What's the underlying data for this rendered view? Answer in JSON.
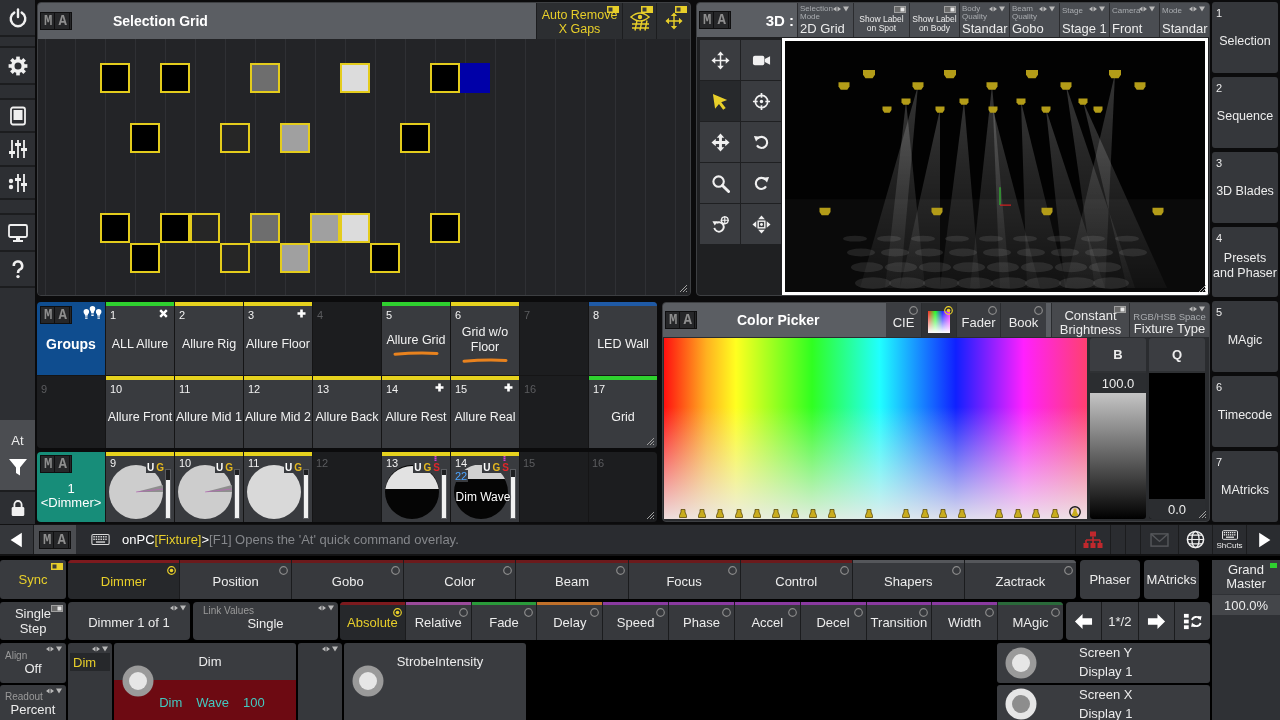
{
  "left_toolbar": {
    "filter_label": "At"
  },
  "selection_grid": {
    "logo": "MA",
    "title": "Selection Grid",
    "buttons": [
      {
        "kind": "text",
        "label": "Auto Remove X Gaps",
        "on": true
      },
      {
        "kind": "eye-grid",
        "on": true
      },
      {
        "kind": "move",
        "on": true
      }
    ],
    "rows": [
      {
        "cells": [
          {
            "color": "#000000",
            "selected": true
          },
          null,
          {
            "color": "#000000",
            "selected": true
          },
          null,
          null,
          {
            "color": "#6e6e6e",
            "selected": true
          },
          null,
          null,
          {
            "color": "#dcdcdc",
            "selected": true
          },
          null,
          null,
          {
            "color": "#000000",
            "selected": true
          },
          {
            "color": "#0000a8",
            "selected": false
          }
        ]
      },
      {
        "cells": [
          null,
          null,
          null,
          null,
          null,
          null,
          null,
          null,
          null,
          null,
          null,
          null,
          null
        ]
      },
      {
        "cells": [
          null,
          {
            "color": "#000000",
            "selected": true
          },
          null,
          null,
          {
            "color": "#262626",
            "selected": true
          },
          null,
          {
            "color": "#a0a0a0",
            "selected": true
          },
          null,
          null,
          null,
          {
            "color": "#000000",
            "selected": true
          },
          null,
          null
        ]
      },
      {
        "cells": [
          null,
          null,
          null,
          null,
          null,
          null,
          null,
          null,
          null,
          null,
          null,
          null,
          null
        ]
      },
      {
        "cells": [
          null,
          null,
          null,
          null,
          null,
          null,
          null,
          null,
          null,
          null,
          null,
          null,
          null
        ]
      },
      {
        "cells": [
          {
            "color": "#000000",
            "selected": true
          },
          null,
          {
            "color": "#000000",
            "selected": true
          },
          {
            "color": "#262626",
            "selected": true
          },
          null,
          {
            "color": "#6e6e6e",
            "selected": true
          },
          null,
          {
            "color": "#a0a0a0",
            "selected": true
          },
          {
            "color": "#dcdcdc",
            "selected": true
          },
          null,
          null,
          {
            "color": "#000000",
            "selected": true
          },
          null
        ]
      },
      {
        "cells": [
          null,
          {
            "color": "#000000",
            "selected": true
          },
          null,
          null,
          {
            "color": "#262626",
            "selected": true
          },
          null,
          {
            "color": "#a0a0a0",
            "selected": true
          },
          null,
          null,
          {
            "color": "#000000",
            "selected": true
          },
          null,
          null,
          null
        ]
      }
    ]
  },
  "viewer_3d": {
    "logo": "MA",
    "title": "3D :",
    "options": [
      {
        "kind": "select",
        "title": "Selection Mode",
        "value": "2D Grid"
      },
      {
        "kind": "toggle",
        "label": "Show Label on Spot",
        "on": false
      },
      {
        "kind": "toggle",
        "label": "Show Label on Body",
        "on": false
      },
      {
        "kind": "select",
        "title": "Body Quality",
        "value": "Standar"
      },
      {
        "kind": "select",
        "title": "Beam Quality",
        "value": "Gobo"
      },
      {
        "kind": "select",
        "title": "Stage",
        "value": "Stage 1"
      },
      {
        "kind": "select",
        "title": "Camera",
        "value": "Front"
      },
      {
        "kind": "select",
        "title": "Mode",
        "value": "Standar"
      }
    ],
    "tools": [
      {
        "selected": false
      },
      {
        "selected": false
      },
      {
        "selected": true
      },
      {
        "selected": false
      },
      {
        "selected": false
      },
      {
        "selected": false
      },
      {
        "selected": false
      },
      {
        "selected": false
      },
      {
        "selected": false
      },
      {
        "selected": false
      }
    ]
  },
  "view_buttons": [
    {
      "number": "1",
      "label": "Selection"
    },
    {
      "number": "2",
      "label": "Sequence"
    },
    {
      "number": "3",
      "label": "3D Blades"
    },
    {
      "number": "4",
      "label": "Presets and Phaser"
    },
    {
      "number": "5",
      "label": "MAgic"
    },
    {
      "number": "6",
      "label": "Timecode"
    },
    {
      "number": "7",
      "label": "MAtricks"
    }
  ],
  "groups_pool": {
    "logo": "MA",
    "title": "Groups",
    "items": [
      {
        "number": "1",
        "kind": "cross",
        "label": "ALL Allure",
        "color": "#2fd12f",
        "highlighted": false
      },
      {
        "number": "2",
        "kind": "plain",
        "label": "Allure Rig",
        "color": "#e6d21e",
        "highlighted": false
      },
      {
        "number": "3",
        "kind": "plus",
        "label": "Allure Floor",
        "color": "#e6d21e",
        "highlighted": false
      },
      {
        "number": "4",
        "kind": "empty"
      },
      {
        "number": "5",
        "kind": "plain",
        "label": "Allure Grid",
        "color": "#2fd12f",
        "highlighted": true
      },
      {
        "number": "6",
        "kind": "plain",
        "label": "Grid w/o Floor",
        "color": "#e6d21e",
        "highlighted": true
      },
      {
        "number": "7",
        "kind": "empty"
      },
      {
        "number": "8",
        "kind": "plain",
        "label": "LED Wall",
        "color": "#1f5aa6",
        "highlighted": false
      },
      {
        "number": "9",
        "kind": "empty"
      },
      {
        "number": "10",
        "kind": "plain",
        "label": "Allure Front",
        "color": "#e6d21e",
        "highlighted": false
      },
      {
        "number": "11",
        "kind": "plain",
        "label": "Allure Mid 1",
        "color": "#e6d21e",
        "highlighted": false
      },
      {
        "number": "12",
        "kind": "plain",
        "label": "Allure Mid 2",
        "color": "#e6d21e",
        "highlighted": false
      },
      {
        "number": "13",
        "kind": "plain",
        "label": "Allure Back",
        "color": "#e6d21e",
        "highlighted": false
      },
      {
        "number": "14",
        "kind": "plus",
        "label": "Allure Rest",
        "color": "#e6d21e",
        "highlighted": false
      },
      {
        "number": "15",
        "kind": "plus",
        "label": "Allure Real",
        "color": "#e6d21e",
        "highlighted": false
      },
      {
        "number": "16",
        "kind": "empty"
      },
      {
        "number": "17",
        "kind": "plain",
        "label": "Grid",
        "color": "#2fd12f",
        "highlighted": false
      }
    ]
  },
  "dimmer_pool": {
    "logo": "MA",
    "number": "1",
    "title": "<Dimmer>",
    "items": [
      {
        "number": "9",
        "kind": "pie",
        "color": "#e6d21e",
        "tags": [
          {
            "text": "U",
            "color": "#ffffff"
          },
          {
            "text": "G",
            "color": "#e6b91e"
          }
        ],
        "phaser": false,
        "level": 0.8
      },
      {
        "number": "10",
        "kind": "pie",
        "color": "#e6d21e",
        "tags": [
          {
            "text": "U",
            "color": "#ffffff"
          },
          {
            "text": "G",
            "color": "#e6b91e"
          }
        ],
        "phaser": false,
        "level": 0.9
      },
      {
        "number": "11",
        "kind": "full",
        "color": "#e6d21e",
        "tags": [
          {
            "text": "U",
            "color": "#ffffff"
          },
          {
            "text": "G",
            "color": "#e6b91e"
          }
        ],
        "phaser": false,
        "level": 0.9
      },
      {
        "number": "12",
        "kind": "empty"
      },
      {
        "number": "13",
        "kind": "half",
        "color": "#e6d21e",
        "tags": [
          {
            "text": "U",
            "color": "#ffffff"
          },
          {
            "text": "G",
            "color": "#e6b91e"
          },
          {
            "text": "S",
            "color": "#e0262b"
          }
        ],
        "phaser": true,
        "level": 0.9
      },
      {
        "number": "14",
        "kind": "wave",
        "label": "Dim Wave",
        "count": "22",
        "color": "#e6d21e",
        "tags": [
          {
            "text": "U",
            "color": "#ffffff"
          },
          {
            "text": "G",
            "color": "#e6b91e"
          },
          {
            "text": "S",
            "color": "#e0262b"
          }
        ],
        "phaser": true,
        "level": 0.85
      },
      {
        "number": "15",
        "kind": "empty"
      },
      {
        "number": "16",
        "kind": "empty"
      }
    ]
  },
  "color_picker": {
    "logo": "MA",
    "title": "Color Picker",
    "tabs": [
      {
        "kind": "text",
        "label": "CIE",
        "selected": false
      },
      {
        "kind": "swatch",
        "selected": true
      },
      {
        "kind": "text",
        "label": "Fader",
        "selected": false
      },
      {
        "kind": "text",
        "label": "Book",
        "selected": false
      }
    ],
    "options": [
      {
        "kind": "toggle",
        "label": "Constant Brightness",
        "on": false
      },
      {
        "kind": "select",
        "title": "RGB/HSB Space",
        "value": "Fixture Type"
      }
    ],
    "faders": [
      {
        "label": "B",
        "reading": "100.0",
        "level": 1
      },
      {
        "label": "Q",
        "reading": "0.0",
        "level": 0
      }
    ]
  },
  "command_line": {
    "logo": "MA",
    "prompt": "onPC",
    "destination": "[Fixture]",
    "separator": ">",
    "hint": "[F1] Opens the 'At' quick command overlay.",
    "shortcuts_label": "ShCuts"
  },
  "encoder_bar": {
    "sync": {
      "label": "Sync",
      "on": true
    },
    "single_step": {
      "label": "Single Step",
      "on": false
    },
    "align": {
      "title": "Align",
      "value": "Off"
    },
    "readout": {
      "title": "Readout",
      "value": "Percent"
    },
    "features": [
      {
        "label": "Dimmer",
        "selected": true,
        "color": "#7d1a1e"
      },
      {
        "label": "Position",
        "selected": false,
        "color": "#6b1a1c"
      },
      {
        "label": "Gobo",
        "selected": false,
        "color": "#6b1a1c"
      },
      {
        "label": "Color",
        "selected": false,
        "color": "#6b1a1c"
      },
      {
        "label": "Beam",
        "selected": false,
        "color": "#6b1a1c"
      },
      {
        "label": "Focus",
        "selected": false,
        "color": "#6b1a1c"
      },
      {
        "label": "Control",
        "selected": false,
        "color": "#6b1a1c"
      },
      {
        "label": "Shapers",
        "selected": false,
        "color": "#55575b"
      },
      {
        "label": "Zactrack",
        "selected": false,
        "color": "#55575b"
      }
    ],
    "extra_buttons": [
      {
        "label": "Phaser"
      },
      {
        "label": "MAtricks"
      }
    ],
    "grand_master": {
      "label": "Grand Master",
      "reading": "100.0%",
      "on": true
    },
    "selection": {
      "value": "Dimmer 1 of 1"
    },
    "link_values": {
      "title": "Link Values",
      "value": "Single"
    },
    "layers": [
      {
        "label": "Absolute",
        "selected": true,
        "color": "#7d1a1e"
      },
      {
        "label": "Relative",
        "selected": false,
        "color": "#9a4a9a"
      },
      {
        "label": "Fade",
        "selected": false,
        "color": "#2a9a3a"
      },
      {
        "label": "Delay",
        "selected": false,
        "color": "#c0702a"
      },
      {
        "label": "Speed",
        "selected": false,
        "color": "#8a3aa0"
      },
      {
        "label": "Phase",
        "selected": false,
        "color": "#8a3aa0"
      },
      {
        "label": "Accel",
        "selected": false,
        "color": "#8a3aa0"
      },
      {
        "label": "Decel",
        "selected": false,
        "color": "#8a3aa0"
      },
      {
        "label": "Transition",
        "selected": false,
        "color": "#8a3aa0"
      },
      {
        "label": "Width",
        "selected": false,
        "color": "#8a3aa0"
      },
      {
        "label": "MAgic",
        "selected": false,
        "color": "#2a6a3a"
      }
    ],
    "page": "1*/2",
    "encoders": [
      {
        "selector": "Dim",
        "label": "Dim",
        "values": [
          "Dim",
          "Wave",
          "100"
        ]
      },
      {
        "label": "StrobeIntensity"
      }
    ],
    "screen_encoders": [
      {
        "label": "Screen Y",
        "sublabel": "Display 1",
        "active": false
      },
      {
        "label": "Screen X",
        "sublabel": "Display 1",
        "active": true
      }
    ]
  }
}
